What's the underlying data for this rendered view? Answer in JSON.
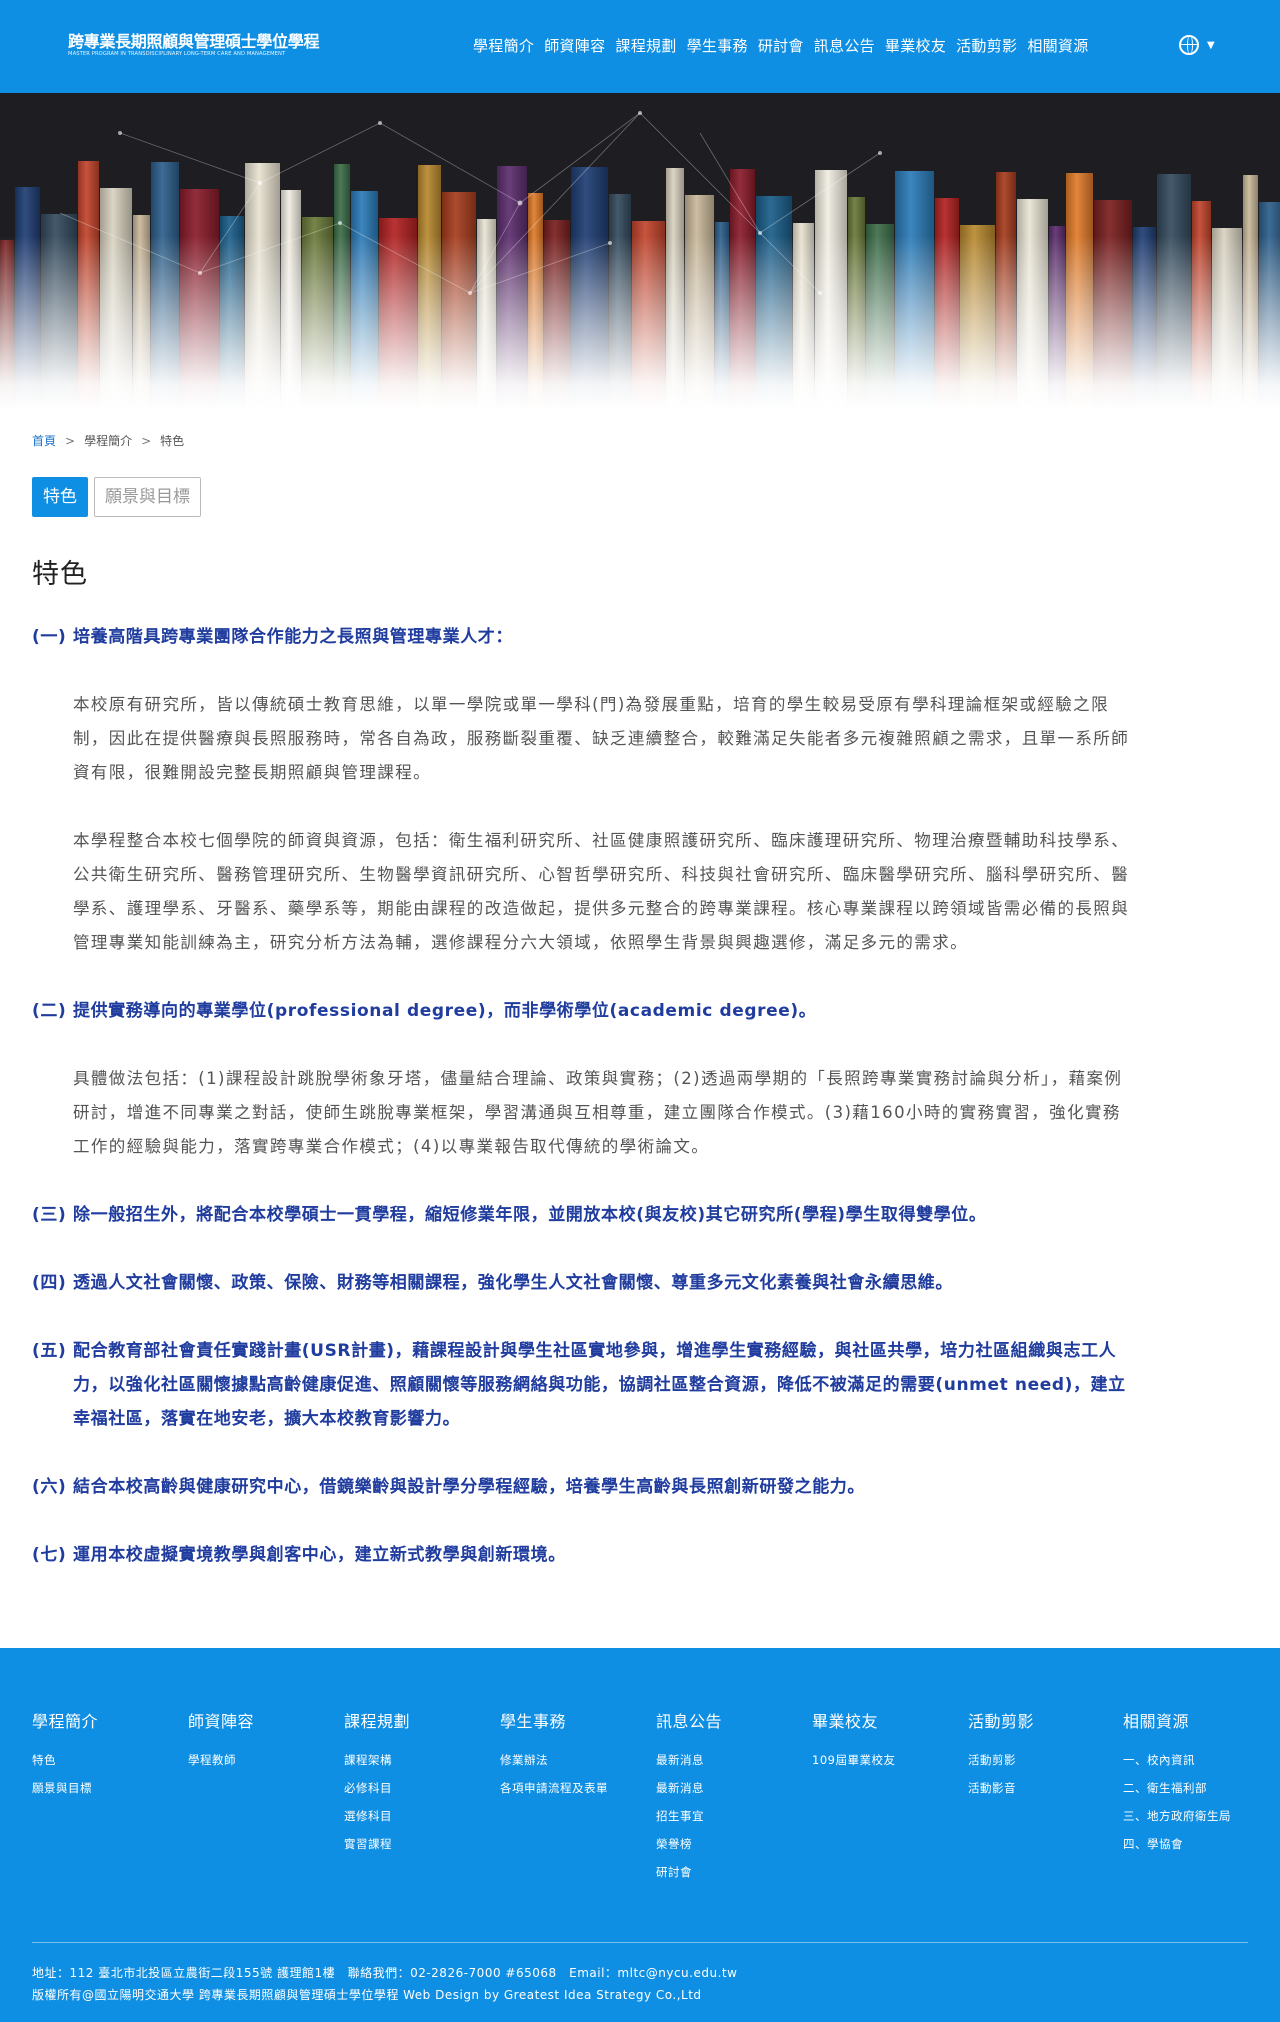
{
  "header": {
    "logo_title": "跨專業長期照顧與管理碩士學位學程",
    "logo_subtitle": "MASTER PROGRAM IN TRANSDISCIPLINARY LONG-TERM CARE AND MANAGEMENT",
    "nav": [
      "學程簡介",
      "師資陣容",
      "課程規劃",
      "學生事務",
      "研討會",
      "訊息公告",
      "畢業校友",
      "活動剪影",
      "相關資源"
    ],
    "lang_icon": "globe-icon"
  },
  "breadcrumb": {
    "home": "首頁",
    "parent": "學程簡介",
    "current": "特色",
    "separator": ">"
  },
  "tabs": [
    "特色",
    "願景與目標"
  ],
  "page_title": "特色",
  "content": {
    "h1_num": "(一)",
    "h1_text": "培養高階具跨專業團隊合作能力之長照與管理專業人才：",
    "p1": "本校原有研究所，皆以傳統碩士教育思維，以單一學院或單一學科(門)為發展重點，培育的學生較易受原有學科理論框架或經驗之限制，因此在提供醫療與長照服務時，常各自為政，服務斷裂重覆、缺乏連續整合，較難滿足失能者多元複雜照顧之需求，且單一系所師資有限，很難開設完整長期照顧與管理課程。",
    "p2": "本學程整合本校七個學院的師資與資源，包括：衛生福利研究所、社區健康照護研究所、臨床護理研究所、物理治療暨輔助科技學系、公共衛生研究所、醫務管理研究所、生物醫學資訊研究所、心智哲學研究所、科技與社會研究所、臨床醫學研究所、腦科學研究所、醫學系、護理學系、牙醫系、藥學系等，期能由課程的改造做起，提供多元整合的跨專業課程。核心專業課程以跨領域皆需必備的長照與管理專業知能訓練為主，研究分析方法為輔，選修課程分六大領域，依照學生背景與興趣選修，滿足多元的需求。",
    "h2_num": "(二)",
    "h2_text": "提供實務導向的專業學位(professional degree)，而非學術學位(academic degree)。",
    "p3": "具體做法包括：(1)課程設計跳脫學術象牙塔，儘量結合理論、政策與實務；(2)透過兩學期的「長照跨專業實務討論與分析」，藉案例研討，增進不同專業之對話，使師生跳脫專業框架，學習溝通與互相尊重，建立團隊合作模式。(3)藉160小時的實務實習，強化實務工作的經驗與能力，落實跨專業合作模式；(4)以專業報告取代傳統的學術論文。",
    "h3_num": "(三)",
    "h3_text": "除一般招生外，將配合本校學碩士一貫學程，縮短修業年限，並開放本校(與友校)其它研究所(學程)學生取得雙學位。",
    "h4_num": "(四)",
    "h4_text": "透過人文社會關懷、政策、保險、財務等相關課程，強化學生人文社會關懷、尊重多元文化素養與社會永續思維。",
    "h5_num": "(五)",
    "h5_text": "配合教育部社會責任實踐計畫(USR計畫)，藉課程設計與學生社區實地參與，增進學生實務經驗，與社區共學，培力社區組織與志工人力，以強化社區關懷據點高齡健康促進、照顧關懷等服務網絡與功能，協調社區整合資源，降低不被滿足的需要(unmet need)，建立幸福社區，落實在地安老，擴大本校教育影響力。",
    "h6_num": "(六)",
    "h6_text": "結合本校高齡與健康研究中心，借鏡樂齡與設計學分學程經驗，培養學生高齡與長照創新研發之能力。",
    "h7_num": "(七)",
    "h7_text": "運用本校虛擬實境教學與創客中心，建立新式教學與創新環境。"
  },
  "footer": {
    "columns": [
      {
        "title": "學程簡介",
        "links": [
          "特色",
          "願景與目標"
        ]
      },
      {
        "title": "師資陣容",
        "links": [
          "學程教師"
        ]
      },
      {
        "title": "課程規劃",
        "links": [
          "課程架構",
          "必修科目",
          "選修科目",
          "實習課程"
        ]
      },
      {
        "title": "學生事務",
        "links": [
          "修業辦法",
          "各項申請流程及表單"
        ]
      },
      {
        "title": "訊息公告",
        "links": [
          "最新消息",
          "最新消息",
          "招生事宜",
          "榮譽榜",
          "研討會"
        ]
      },
      {
        "title": "畢業校友",
        "links": [
          "109屆畢業校友"
        ]
      },
      {
        "title": "活動剪影",
        "links": [
          "活動剪影",
          "活動影音"
        ]
      },
      {
        "title": "相關資源",
        "links": [
          "一、校內資訊",
          "二、衛生福利部",
          "三、地方政府衛生局",
          "四、學協會"
        ]
      }
    ],
    "address": "地址：112 臺北市北投區立農街二段155號 護理館1樓　聯絡我們：02-2826-7000 #65068　Email：mltc@nycu.edu.tw",
    "copyright": "版權所有@國立陽明交通大學 跨專業長期照顧與管理碩士學位學程 Web Design by Greatest Idea Strategy Co.,Ltd"
  }
}
